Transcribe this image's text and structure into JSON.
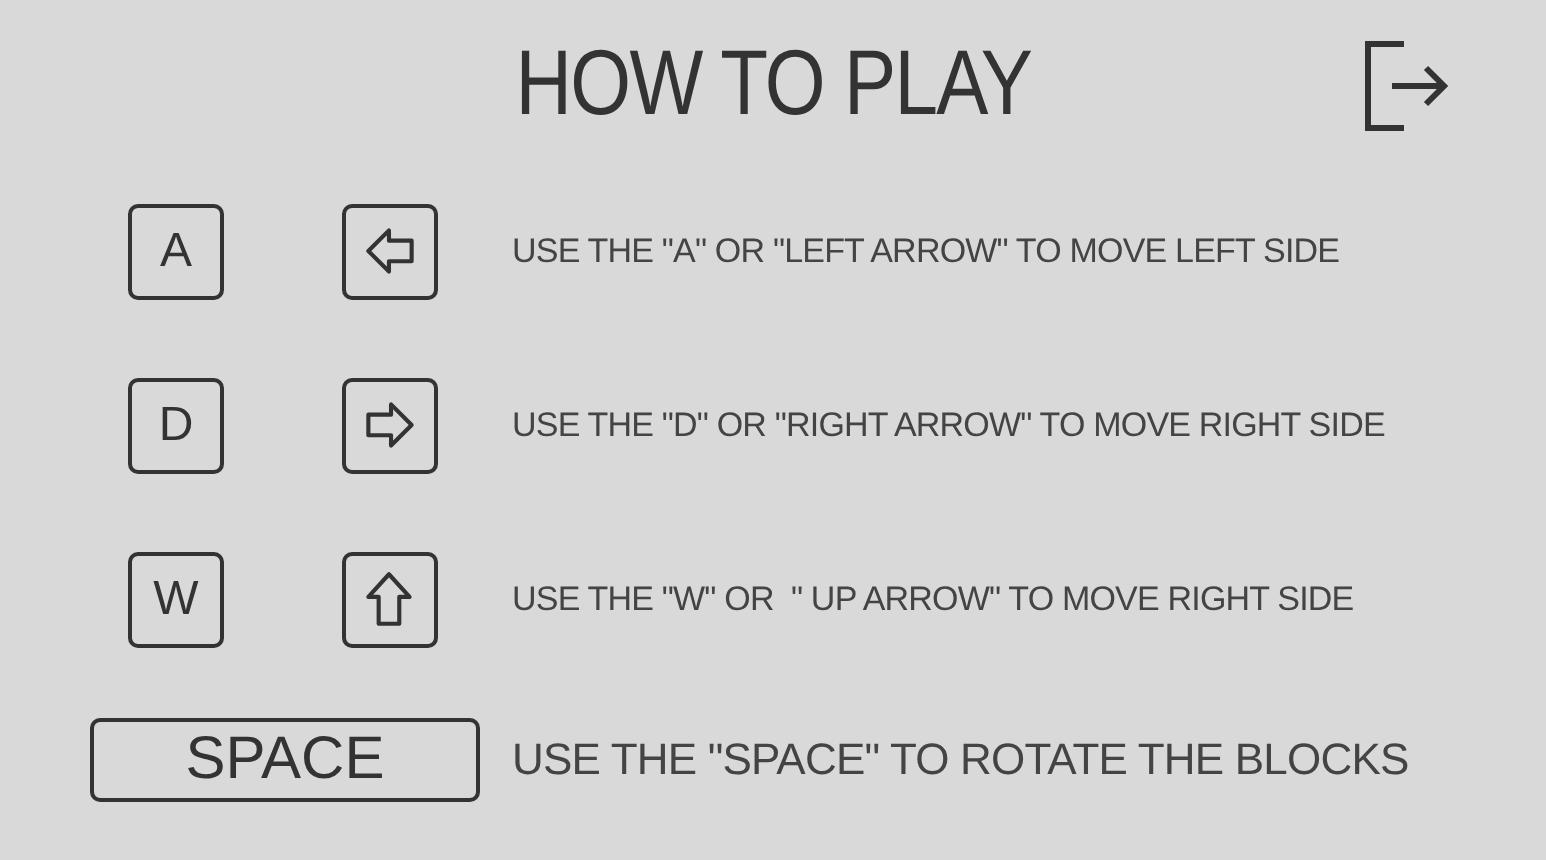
{
  "title": "HOW TO PLAY",
  "controls": [
    {
      "keys": [
        {
          "kind": "letter",
          "label": "A"
        },
        {
          "kind": "arrow_left"
        }
      ],
      "description": "USE THE \"A\" OR \"LEFT ARROW\" TO MOVE LEFT SIDE"
    },
    {
      "keys": [
        {
          "kind": "letter",
          "label": "D"
        },
        {
          "kind": "arrow_right"
        }
      ],
      "description": "USE THE \"D\" OR \"RIGHT ARROW\" TO MOVE RIGHT SIDE"
    },
    {
      "keys": [
        {
          "kind": "letter",
          "label": "W"
        },
        {
          "kind": "arrow_up"
        }
      ],
      "description": "USE THE \"W\" OR  \" UP ARROW\" TO MOVE RIGHT SIDE"
    },
    {
      "keys": [
        {
          "kind": "wide",
          "label": "SPACE"
        }
      ],
      "description": "USE THE \"SPACE\" TO ROTATE THE BLOCKS"
    }
  ]
}
